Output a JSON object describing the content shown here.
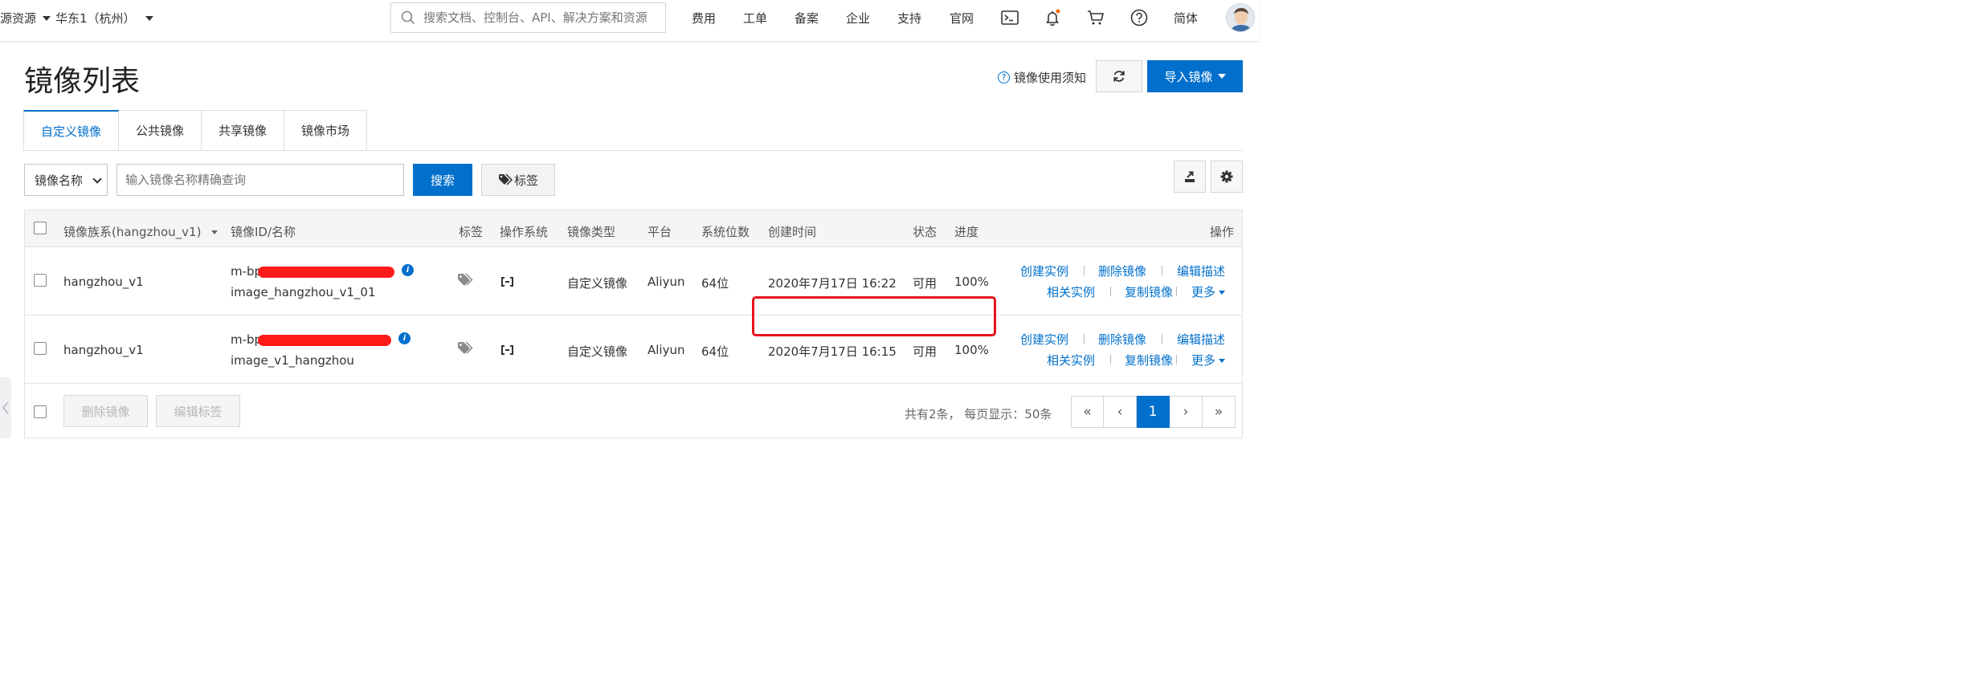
{
  "topbar": {
    "resource_menu": "源资源",
    "region_menu": "华东1（杭州）",
    "search_placeholder": "搜索文档、控制台、API、解决方案和资源",
    "nav": [
      "费用",
      "工单",
      "备案",
      "企业",
      "支持",
      "官网"
    ],
    "language": "简体",
    "icons": [
      "terminal-icon",
      "bell-icon",
      "cart-icon",
      "help-icon"
    ]
  },
  "page": {
    "title": "镜像列表",
    "help_link": "镜像使用须知",
    "import_button": "导入镜像"
  },
  "tabs": [
    "自定义镜像",
    "公共镜像",
    "共享镜像",
    "镜像市场"
  ],
  "filter": {
    "select_value": "镜像名称",
    "input_placeholder": "输入镜像名称精确查询",
    "search_button": "搜索",
    "tag_button": "标签"
  },
  "table": {
    "headers": {
      "family": "镜像族系(hangzhou_v1)",
      "id_name": "镜像ID/名称",
      "tag": "标签",
      "os": "操作系统",
      "type": "镜像类型",
      "platform": "平台",
      "bits": "系统位数",
      "created": "创建时间",
      "status": "状态",
      "progress": "进度",
      "actions": "操作"
    },
    "rows": [
      {
        "family": "hangzhou_v1",
        "id": "m-bp1",
        "name": "image_hangzhou_v1_01",
        "type": "自定义镜像",
        "platform": "Aliyun",
        "bits": "64位",
        "created": "2020年7月17日 16:22",
        "status": "可用",
        "progress": "100%"
      },
      {
        "family": "hangzhou_v1",
        "id": "m-bp1",
        "name": "image_v1_hangzhou",
        "type": "自定义镜像",
        "platform": "Aliyun",
        "bits": "64位",
        "created": "2020年7月17日 16:15",
        "status": "可用",
        "progress": "100%"
      }
    ],
    "row_actions": {
      "create_instance": "创建实例",
      "delete_image": "删除镜像",
      "edit_desc": "编辑描述",
      "related_instances": "相关实例",
      "copy_image": "复制镜像",
      "more": "更多"
    }
  },
  "footer": {
    "delete_button": "删除镜像",
    "edit_tags_button": "编辑标签",
    "total_text": "共有2条， 每页显示：50条",
    "pager": [
      "«",
      "‹",
      "1",
      "›",
      "»"
    ],
    "current_page": "1"
  },
  "colors": {
    "primary": "#0070cc",
    "highlight": "#e8131e",
    "redaction": "#ff1a1a",
    "notify_dot": "#ff6a00"
  }
}
